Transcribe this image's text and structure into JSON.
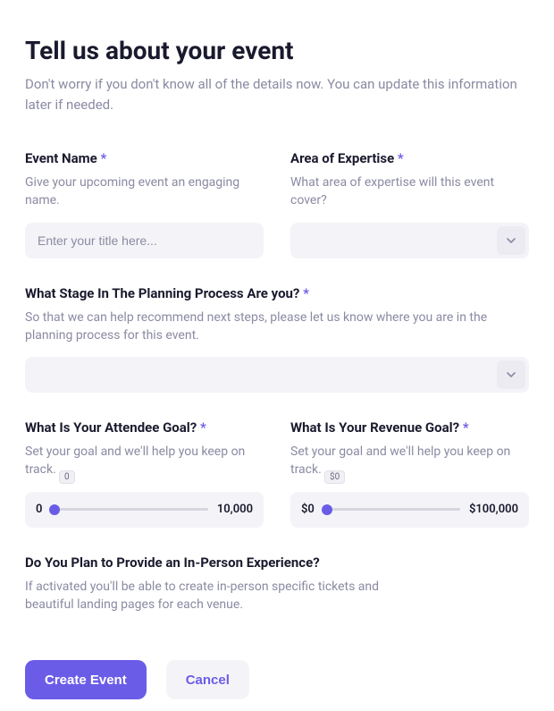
{
  "header": {
    "title": "Tell us about your event",
    "subtitle": "Don't worry if you don't know all of the details now. You can update this information later if needed."
  },
  "fields": {
    "event_name": {
      "label": "Event Name",
      "required_marker": "*",
      "help": "Give your upcoming event an engaging name.",
      "placeholder": "Enter your title here..."
    },
    "expertise": {
      "label": "Area of Expertise",
      "required_marker": "*",
      "help": "What area of expertise will this event cover?"
    },
    "stage": {
      "label": "What Stage In The Planning Process Are you?",
      "required_marker": "*",
      "help": "So that we can help recommend next steps, please let us know where you are in the planning process for this event."
    },
    "attendee_goal": {
      "label": "What Is Your Attendee Goal?",
      "required_marker": "*",
      "help": "Set your goal and we'll help you keep on track.",
      "min_label": "0",
      "max_label": "10,000",
      "tooltip": "0"
    },
    "revenue_goal": {
      "label": "What Is Your Revenue Goal?",
      "required_marker": "*",
      "help": "Set your goal and we'll help you keep on track.",
      "min_label": "$0",
      "max_label": "$100,000",
      "tooltip": "$0"
    },
    "in_person": {
      "label": "Do You Plan to Provide an In-Person Experience?",
      "help": "If activated you'll be able to create in-person specific tickets and beautiful landing pages for each venue."
    }
  },
  "actions": {
    "primary": "Create Event",
    "secondary": "Cancel"
  }
}
